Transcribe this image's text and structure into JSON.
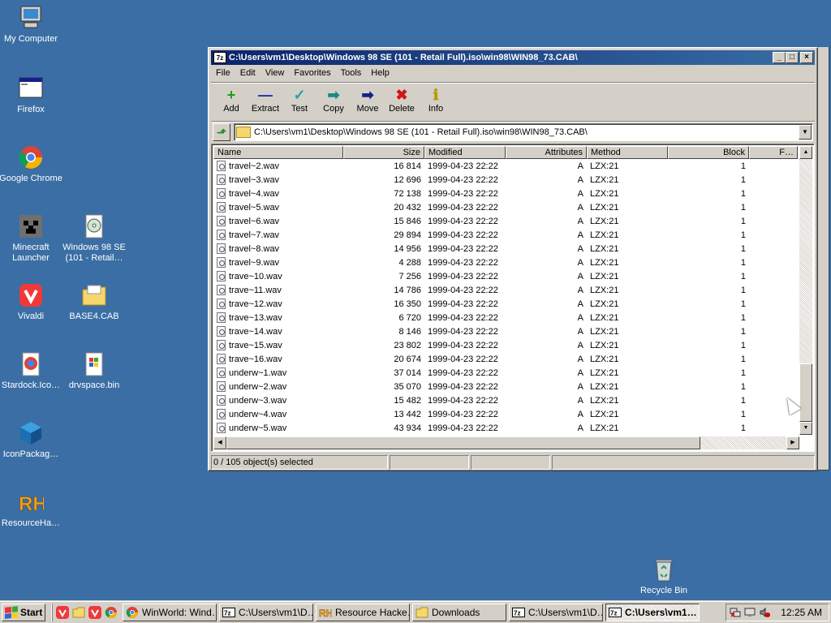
{
  "desktop": {
    "icons": [
      {
        "label": "My Computer",
        "icon": "my-computer-icon"
      },
      {
        "label": "Firefox",
        "icon": "firefox-icon"
      },
      {
        "label": "Google Chrome",
        "icon": "chrome-icon"
      },
      {
        "label": "Minecraft Launcher",
        "icon": "minecraft-icon"
      },
      {
        "label": "Windows 98 SE (101 - Retail…",
        "icon": "iso-disc-icon"
      },
      {
        "label": "Vivaldi",
        "icon": "vivaldi-icon"
      },
      {
        "label": "BASE4.CAB",
        "icon": "cab-folder-icon"
      },
      {
        "label": "Stardock.Ico…",
        "icon": "stardock-icon"
      },
      {
        "label": "drvspace.bin",
        "icon": "bin-file-icon"
      },
      {
        "label": "IconPackag…",
        "icon": "iconpackager-icon"
      },
      {
        "label": "ResourceHa…",
        "icon": "resource-hacker-icon"
      },
      {
        "label": "Recycle Bin",
        "icon": "recycle-bin-icon"
      }
    ]
  },
  "window": {
    "title": "C:\\Users\\vm1\\Desktop\\Windows 98 SE (101 - Retail Full).iso\\win98\\WIN98_73.CAB\\",
    "app_badge": "7z",
    "menu": [
      "File",
      "Edit",
      "View",
      "Favorites",
      "Tools",
      "Help"
    ],
    "toolbar": [
      {
        "label": "Add",
        "glyph": "+",
        "color": "#1a9e1a"
      },
      {
        "label": "Extract",
        "glyph": "—",
        "color": "#1a2fb5"
      },
      {
        "label": "Test",
        "glyph": "✓",
        "color": "#1aa6a6"
      },
      {
        "label": "Copy",
        "glyph": "➡",
        "color": "#1a8a8a"
      },
      {
        "label": "Move",
        "glyph": "➡",
        "color": "#16208a"
      },
      {
        "label": "Delete",
        "glyph": "✖",
        "color": "#d01616"
      },
      {
        "label": "Info",
        "glyph": "ℹ",
        "color": "#b59a00"
      }
    ],
    "address": "C:\\Users\\vm1\\Desktop\\Windows 98 SE (101 - Retail Full).iso\\win98\\WIN98_73.CAB\\",
    "columns": [
      "Name",
      "Size",
      "Modified",
      "Attributes",
      "Method",
      "Block",
      "F…"
    ],
    "files": [
      {
        "name": "travel~2.wav",
        "size": "16 814",
        "modified": "1999-04-23 22:22",
        "attr": "A",
        "method": "LZX:21",
        "block": "1"
      },
      {
        "name": "travel~3.wav",
        "size": "12 696",
        "modified": "1999-04-23 22:22",
        "attr": "A",
        "method": "LZX:21",
        "block": "1"
      },
      {
        "name": "travel~4.wav",
        "size": "72 138",
        "modified": "1999-04-23 22:22",
        "attr": "A",
        "method": "LZX:21",
        "block": "1"
      },
      {
        "name": "travel~5.wav",
        "size": "20 432",
        "modified": "1999-04-23 22:22",
        "attr": "A",
        "method": "LZX:21",
        "block": "1"
      },
      {
        "name": "travel~6.wav",
        "size": "15 846",
        "modified": "1999-04-23 22:22",
        "attr": "A",
        "method": "LZX:21",
        "block": "1"
      },
      {
        "name": "travel~7.wav",
        "size": "29 894",
        "modified": "1999-04-23 22:22",
        "attr": "A",
        "method": "LZX:21",
        "block": "1"
      },
      {
        "name": "travel~8.wav",
        "size": "14 956",
        "modified": "1999-04-23 22:22",
        "attr": "A",
        "method": "LZX:21",
        "block": "1"
      },
      {
        "name": "travel~9.wav",
        "size": "4 288",
        "modified": "1999-04-23 22:22",
        "attr": "A",
        "method": "LZX:21",
        "block": "1"
      },
      {
        "name": "trave~10.wav",
        "size": "7 256",
        "modified": "1999-04-23 22:22",
        "attr": "A",
        "method": "LZX:21",
        "block": "1"
      },
      {
        "name": "trave~11.wav",
        "size": "14 786",
        "modified": "1999-04-23 22:22",
        "attr": "A",
        "method": "LZX:21",
        "block": "1"
      },
      {
        "name": "trave~12.wav",
        "size": "16 350",
        "modified": "1999-04-23 22:22",
        "attr": "A",
        "method": "LZX:21",
        "block": "1"
      },
      {
        "name": "trave~13.wav",
        "size": "6 720",
        "modified": "1999-04-23 22:22",
        "attr": "A",
        "method": "LZX:21",
        "block": "1"
      },
      {
        "name": "trave~14.wav",
        "size": "8 146",
        "modified": "1999-04-23 22:22",
        "attr": "A",
        "method": "LZX:21",
        "block": "1"
      },
      {
        "name": "trave~15.wav",
        "size": "23 802",
        "modified": "1999-04-23 22:22",
        "attr": "A",
        "method": "LZX:21",
        "block": "1"
      },
      {
        "name": "trave~16.wav",
        "size": "20 674",
        "modified": "1999-04-23 22:22",
        "attr": "A",
        "method": "LZX:21",
        "block": "1"
      },
      {
        "name": "underw~1.wav",
        "size": "37 014",
        "modified": "1999-04-23 22:22",
        "attr": "A",
        "method": "LZX:21",
        "block": "1"
      },
      {
        "name": "underw~2.wav",
        "size": "35 070",
        "modified": "1999-04-23 22:22",
        "attr": "A",
        "method": "LZX:21",
        "block": "1"
      },
      {
        "name": "underw~3.wav",
        "size": "15 482",
        "modified": "1999-04-23 22:22",
        "attr": "A",
        "method": "LZX:21",
        "block": "1"
      },
      {
        "name": "underw~4.wav",
        "size": "13 442",
        "modified": "1999-04-23 22:22",
        "attr": "A",
        "method": "LZX:21",
        "block": "1"
      },
      {
        "name": "underw~5.wav",
        "size": "43 934",
        "modified": "1999-04-23 22:22",
        "attr": "A",
        "method": "LZX:21",
        "block": "1"
      }
    ],
    "status": "0 / 105 object(s) selected"
  },
  "taskbar": {
    "start_label": "Start",
    "tasks": [
      {
        "label": "WinWorld: Wind…",
        "icon": "chrome-icon",
        "active": false
      },
      {
        "label": "C:\\Users\\vm1\\D…",
        "icon": "7zip-icon",
        "active": false
      },
      {
        "label": "Resource Hacke…",
        "icon": "resource-hacker-icon",
        "active": false
      },
      {
        "label": "Downloads",
        "icon": "folder-icon",
        "active": false
      },
      {
        "label": "C:\\Users\\vm1\\D…",
        "icon": "7zip-icon",
        "active": false
      },
      {
        "label": "C:\\Users\\vm1…",
        "icon": "7zip-icon",
        "active": true
      }
    ],
    "clock": "12:25 AM"
  }
}
